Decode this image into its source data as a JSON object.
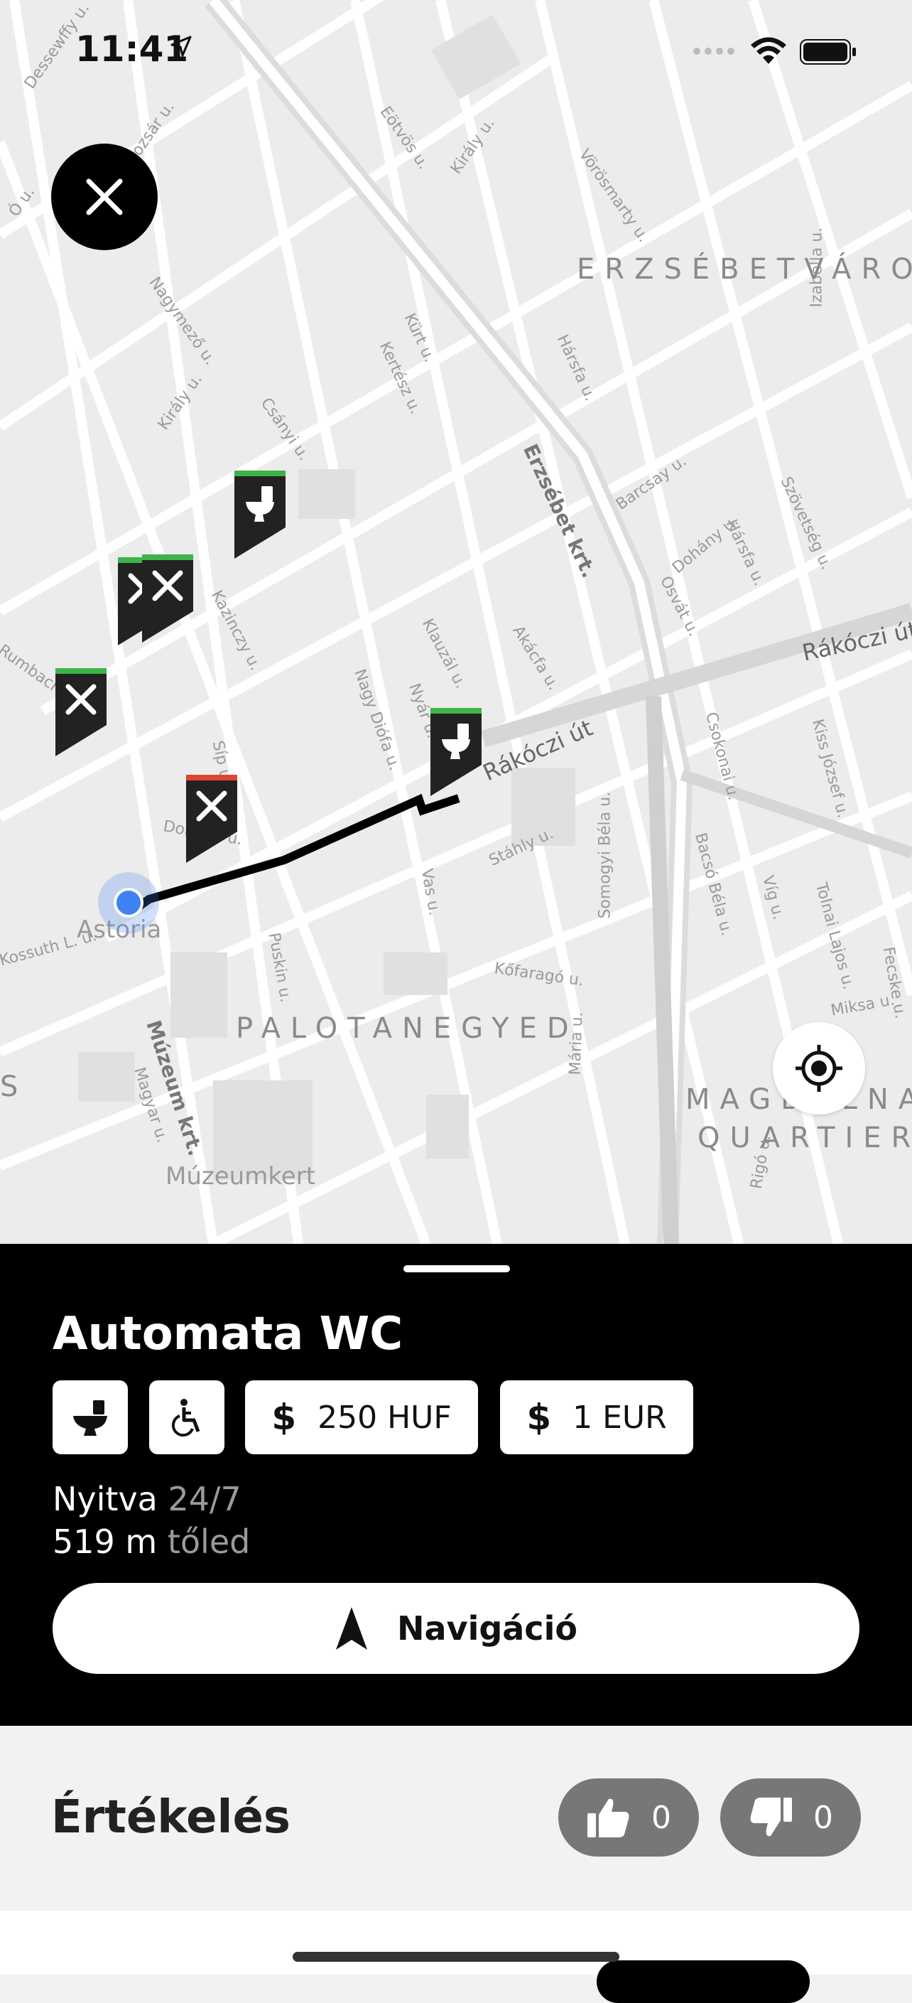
{
  "status_bar": {
    "time": "11:41"
  },
  "map": {
    "districts": [
      "ERZSÉBETVÁRO",
      "PALOTANEGYED",
      "MAGDALNA",
      "QUARTIER",
      "S"
    ],
    "places": [
      "Astoria",
      "Múzeumkert"
    ],
    "streets": [
      "Nagymező u.",
      "Király u.",
      "Csányi u.",
      "Kazinczy u.",
      "Síp u.",
      "Nagy Diófa u.",
      "Klauzál u.",
      "Akácfa u.",
      "Erzsébet krt.",
      "Rákóczi út",
      "Rákóczi út",
      "Barcsay u.",
      "Dohány u.",
      "Osvát u.",
      "Hársfa u.",
      "Hársfa u.",
      "Szövetség u.",
      "Kürt u.",
      "Kertész u.",
      "Eötvös u.",
      "Király u.",
      "Vörösmarty u.",
      "Izabella u.",
      "Csokonai u.",
      "Kiss József u.",
      "Bacsó Béla u.",
      "Víg u.",
      "Tolnai Lajos u.",
      "Stáhly u.",
      "Somogyi Béla u.",
      "Kőfaragó u.",
      "Vas u.",
      "Puskin u.",
      "Múzeum krt.",
      "Magyar u.",
      "Mária u.",
      "Rigó u.",
      "Miksa u.",
      "Fecske u.",
      "Rumbach S.",
      "Dohány u.",
      "Dessewffy u.",
      "Mozsár u.",
      "Ó u.",
      "Nyár u.",
      "Kossuth L. u."
    ],
    "pins": [
      {
        "type": "toilet",
        "status": "green"
      },
      {
        "type": "restaurant",
        "status": "green"
      },
      {
        "type": "restaurant",
        "status": "green"
      },
      {
        "type": "restaurant",
        "status": "green"
      },
      {
        "type": "restaurant",
        "status": "red"
      },
      {
        "type": "toilet",
        "status": "green"
      }
    ]
  },
  "place": {
    "title": "Automata WC",
    "price_huf": "250 HUF",
    "price_eur": "1 EUR",
    "dollar": "$",
    "open_label": "Nyitva",
    "open_hours": "24/7",
    "distance": "519 m",
    "distance_suffix": "tőled",
    "navigate_label": "Navigáció"
  },
  "rating": {
    "title": "Értékelés",
    "likes": "0",
    "dislikes": "0"
  },
  "colors": {
    "green": "#3db34a",
    "red": "#e0462e",
    "user": "#3f83f2"
  }
}
